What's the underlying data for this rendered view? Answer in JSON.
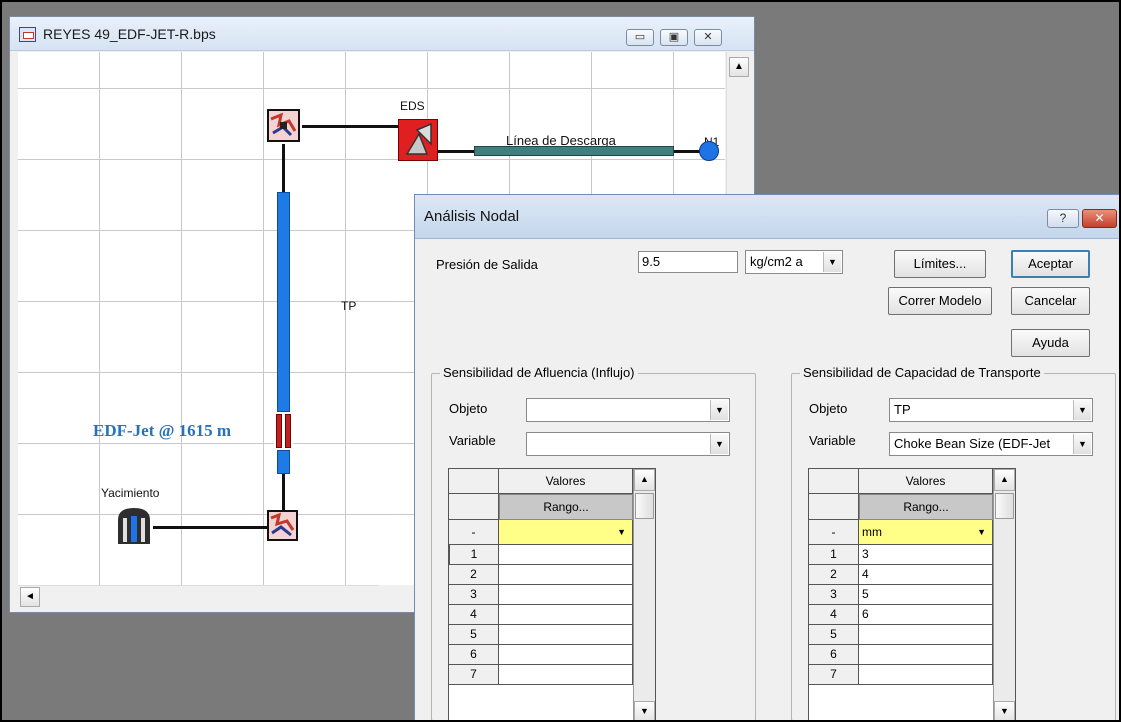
{
  "diagram_window": {
    "title": "REYES 49_EDF-JET-R.bps",
    "controls": {
      "minimize": "▭",
      "maximize": "▣",
      "close": "✕"
    },
    "labels": {
      "eds": "EDS",
      "discharge_line": "Línea de Descarga",
      "n1": "N1",
      "tp": "TP",
      "jet": "EDF-Jet @ 1615 m",
      "reservoir": "Yacimiento"
    },
    "scroll": {
      "up": "▲",
      "left": "◄"
    }
  },
  "dialog": {
    "title": "Análisis Nodal",
    "help_glyph": "?",
    "close_glyph": "✕",
    "outlet_pressure_label": "Presión de Salida",
    "outlet_pressure_value": "9.5",
    "pressure_unit": "kg/cm2 a",
    "buttons": {
      "limits": "Límites...",
      "accept": "Aceptar",
      "run_model": "Correr Modelo",
      "cancel": "Cancelar",
      "help": "Ayuda"
    },
    "inflow_group": {
      "title": "Sensibilidad de Afluencia (Influjo)",
      "object_label": "Objeto",
      "object_value": "",
      "variable_label": "Variable",
      "variable_value": "",
      "grid": {
        "header": "Valores",
        "range_button": "Rango...",
        "unit_row_label": "-",
        "unit": "",
        "row_numbers": [
          "1",
          "2",
          "3",
          "4",
          "5",
          "6",
          "7"
        ],
        "values": [
          "",
          "",
          "",
          "",
          "",
          "",
          ""
        ]
      }
    },
    "transport_group": {
      "title": "Sensibilidad de Capacidad de Transporte",
      "object_label": "Objeto",
      "object_value": "TP",
      "variable_label": "Variable",
      "variable_value": "Choke Bean Size (EDF-Jet",
      "grid": {
        "header": "Valores",
        "range_button": "Rango...",
        "unit_row_label": "-",
        "unit": "mm",
        "row_numbers": [
          "1",
          "2",
          "3",
          "4",
          "5",
          "6",
          "7"
        ],
        "values": [
          "3",
          "4",
          "5",
          "6",
          "",
          "",
          ""
        ]
      }
    }
  }
}
